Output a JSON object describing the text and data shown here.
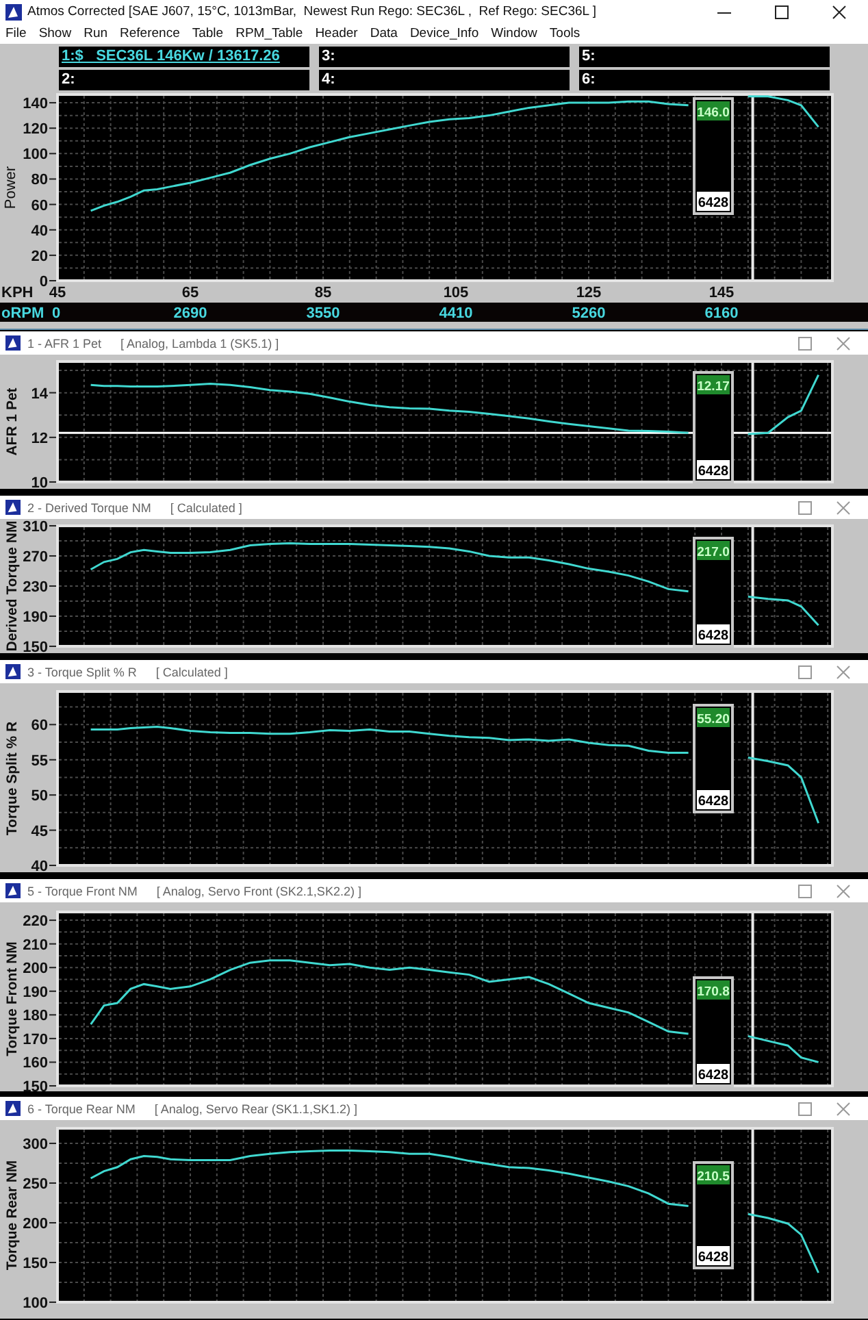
{
  "window": {
    "title": "Atmos Corrected [SAE J607, 15°C, 1013mBar,  Newest Run Rego: SEC36L ,  Ref Rego: SEC36L ]"
  },
  "menu": [
    "File",
    "Show",
    "Run",
    "Reference",
    "Table",
    "RPM_Table",
    "Header",
    "Data",
    "Device_Info",
    "Window",
    "Tools"
  ],
  "run_slots": [
    {
      "label": "1:$   SEC36L 146Kw / 13617.26",
      "selected": true
    },
    {
      "label": "3:",
      "selected": false
    },
    {
      "label": "5:",
      "selected": false
    },
    {
      "label": "2:",
      "selected": false
    },
    {
      "label": "4:",
      "selected": false
    },
    {
      "label": "6:",
      "selected": false
    }
  ],
  "main_chart": {
    "chart_data": {
      "type": "line",
      "xlabel": "KPH",
      "ylabel": "Power",
      "grid": true,
      "x": [
        50,
        52,
        54,
        56,
        58,
        60,
        62,
        65,
        68,
        71,
        74,
        77,
        80,
        83,
        86,
        89,
        92,
        95,
        98,
        101,
        104,
        107,
        110,
        113,
        116,
        119,
        122,
        125,
        128,
        131,
        134,
        137,
        140,
        143,
        146,
        149,
        152,
        155,
        157,
        159.6
      ],
      "series": [
        {
          "color": "#40d8d0",
          "values": [
            55,
            59,
            62,
            66,
            71,
            72,
            74,
            77,
            81,
            85,
            91,
            96,
            100,
            105,
            109,
            113,
            116,
            119,
            122,
            125,
            127,
            128,
            130,
            133,
            136,
            138,
            140,
            140,
            140,
            141,
            141,
            139,
            138,
            null,
            null,
            145,
            145,
            142,
            138,
            121
          ]
        }
      ],
      "xlim": [
        45,
        161.7
      ],
      "ylim": [
        0,
        146.5
      ],
      "xticks": [
        45,
        65,
        85,
        105,
        125,
        145
      ],
      "yticks": [
        0,
        20,
        40,
        60,
        80,
        100,
        120,
        140
      ],
      "ref_lines": [
        {
          "axis": "x",
          "value": 149.7
        }
      ]
    },
    "cursor": {
      "value": "146.0",
      "rpm": "6428"
    },
    "rpm_axis": {
      "label": "oRPM",
      "ticks": [
        "0",
        "2690",
        "3550",
        "4410",
        "5260",
        "6160"
      ]
    }
  },
  "panels": [
    {
      "title": "1 - AFR 1 Pet",
      "source": "[ Analog, Lambda 1 (SK5.1) ]",
      "chart_data": {
        "type": "line",
        "ylabel": "AFR 1 Pet",
        "grid": true,
        "x": [
          50,
          52,
          54,
          56,
          58,
          60,
          62,
          65,
          68,
          71,
          74,
          77,
          80,
          83,
          86,
          89,
          92,
          95,
          98,
          101,
          104,
          107,
          110,
          113,
          116,
          119,
          122,
          125,
          128,
          131,
          134,
          137,
          140,
          143,
          146,
          149,
          152,
          155,
          157,
          159.6
        ],
        "series": [
          {
            "color": "#40d8d0",
            "values": [
              14.35,
              14.3,
              14.3,
              14.28,
              14.28,
              14.28,
              14.3,
              14.35,
              14.4,
              14.35,
              14.25,
              14.12,
              14.05,
              13.95,
              13.78,
              13.6,
              13.45,
              13.35,
              13.3,
              13.28,
              13.2,
              13.15,
              13.05,
              12.95,
              12.85,
              12.72,
              12.6,
              12.5,
              12.4,
              12.3,
              12.28,
              12.25,
              12.2,
              null,
              null,
              12.15,
              12.2,
              12.9,
              13.2,
              14.8
            ]
          }
        ],
        "xlim": [
          45,
          161.7
        ],
        "ylim": [
          10,
          15.4
        ],
        "yticks": [
          10,
          12,
          14
        ],
        "ref_lines": [
          {
            "axis": "y",
            "value": 12.2
          },
          {
            "axis": "x",
            "value": 149.7
          }
        ]
      },
      "cursor": {
        "value": "12.17",
        "rpm": "6428"
      }
    },
    {
      "title": "2 - Derived Torque NM",
      "source": "[ Calculated ]",
      "chart_data": {
        "type": "line",
        "ylabel": "Derived Torque NM",
        "grid": true,
        "x": [
          50,
          52,
          54,
          56,
          58,
          60,
          62,
          65,
          68,
          71,
          74,
          77,
          80,
          83,
          86,
          89,
          92,
          95,
          98,
          101,
          104,
          107,
          110,
          113,
          116,
          119,
          122,
          125,
          128,
          131,
          134,
          137,
          140,
          143,
          146,
          149,
          152,
          155,
          157,
          159.6
        ],
        "series": [
          {
            "color": "#40d8d0",
            "values": [
              252,
              262,
              266,
              275,
              278,
              276,
              274,
              274,
              275,
              278,
              284,
              286,
              287,
              286,
              286,
              286,
              285,
              284,
              283,
              282,
              280,
              276,
              270,
              268,
              268,
              264,
              259,
              253,
              249,
              244,
              236,
              226,
              223,
              null,
              null,
              216,
              213,
              211,
              203,
              178
            ]
          }
        ],
        "xlim": [
          45,
          161.7
        ],
        "ylim": [
          150,
          310
        ],
        "yticks": [
          150,
          190,
          230,
          270,
          310
        ],
        "ref_lines": [
          {
            "axis": "x",
            "value": 149.7
          }
        ]
      },
      "cursor": {
        "value": "217.0",
        "rpm": "6428"
      }
    },
    {
      "title": "3 - Torque Split % R",
      "source": "[ Calculated ]",
      "chart_data": {
        "type": "line",
        "ylabel": "Torque Split % R",
        "grid": true,
        "x": [
          50,
          52,
          54,
          56,
          58,
          60,
          62,
          65,
          68,
          71,
          74,
          77,
          80,
          83,
          86,
          89,
          92,
          95,
          98,
          101,
          104,
          107,
          110,
          113,
          116,
          119,
          122,
          125,
          128,
          131,
          134,
          137,
          140,
          143,
          146,
          149,
          152,
          155,
          157,
          159.6
        ],
        "series": [
          {
            "color": "#40d8d0",
            "values": [
              59.3,
              59.3,
              59.3,
              59.5,
              59.6,
              59.7,
              59.5,
              59.1,
              58.9,
              58.8,
              58.8,
              58.7,
              58.7,
              58.9,
              59.2,
              59.1,
              59.3,
              59.0,
              59.0,
              58.7,
              58.4,
              58.2,
              58.1,
              57.8,
              57.9,
              57.7,
              57.9,
              57.4,
              57.1,
              57.0,
              56.3,
              56.0,
              56.0,
              null,
              null,
              55.3,
              54.8,
              54.2,
              52.5,
              46
            ]
          }
        ],
        "xlim": [
          45,
          161.7
        ],
        "ylim": [
          40,
          64.7
        ],
        "yticks": [
          40,
          45,
          50,
          55,
          60
        ],
        "ref_lines": [
          {
            "axis": "x",
            "value": 149.7
          }
        ]
      },
      "cursor": {
        "value": "55.20",
        "rpm": "6428"
      }
    },
    {
      "title": "5 - Torque Front NM",
      "source": "[ Analog, Servo Front (SK2.1,SK2.2) ]",
      "chart_data": {
        "type": "line",
        "ylabel": "Torque Front NM",
        "grid": true,
        "x": [
          50,
          52,
          54,
          56,
          58,
          60,
          62,
          65,
          68,
          71,
          74,
          77,
          80,
          83,
          86,
          89,
          92,
          95,
          98,
          101,
          104,
          107,
          110,
          113,
          116,
          119,
          122,
          125,
          128,
          131,
          134,
          137,
          140,
          143,
          146,
          149,
          152,
          155,
          157,
          159.6
        ],
        "series": [
          {
            "color": "#40d8d0",
            "values": [
              176,
              184,
              185,
              191,
              193,
              192,
              191,
              192,
              195,
              199,
              202,
              203,
              203,
              202,
              201,
              201.5,
              200,
              199,
              200,
              199,
              198,
              197,
              194,
              195,
              196,
              193,
              189,
              185,
              183,
              181,
              177,
              173,
              172,
              null,
              null,
              171,
              169,
              167,
              162,
              160
            ]
          }
        ],
        "xlim": [
          45,
          161.7
        ],
        "ylim": [
          150,
          223.5
        ],
        "yticks": [
          150,
          160,
          170,
          180,
          190,
          200,
          210,
          220
        ],
        "ref_lines": [
          {
            "axis": "x",
            "value": 149.7
          }
        ]
      },
      "cursor": {
        "value": "170.8",
        "rpm": "6428"
      }
    },
    {
      "title": "6 - Torque Rear NM",
      "source": "[ Analog, Servo Rear (SK1.1,SK1.2) ]",
      "chart_data": {
        "type": "line",
        "ylabel": "Torque Rear NM",
        "grid": true,
        "x": [
          50,
          52,
          54,
          56,
          58,
          60,
          62,
          65,
          68,
          71,
          74,
          77,
          80,
          83,
          86,
          89,
          92,
          95,
          98,
          101,
          104,
          107,
          110,
          113,
          116,
          119,
          122,
          125,
          128,
          131,
          134,
          137,
          140,
          143,
          146,
          149,
          152,
          155,
          157,
          159.6
        ],
        "series": [
          {
            "color": "#40d8d0",
            "values": [
              256,
              265,
              270,
              280,
              284,
              283,
              280,
              279,
              279,
              279,
              284,
              287,
              289,
              290,
              291,
              291,
              290,
              289,
              287,
              287,
              283,
              278,
              274,
              270,
              269,
              266,
              262,
              257,
              252,
              246,
              237,
              224,
              221,
              null,
              null,
              211,
              206,
              199,
              185,
              137
            ]
          }
        ],
        "xlim": [
          45,
          161.7
        ],
        "ylim": [
          100,
          319
        ],
        "yticks": [
          100,
          150,
          200,
          250,
          300
        ],
        "ref_lines": [
          {
            "axis": "x",
            "value": 149.7
          }
        ]
      },
      "cursor": {
        "value": "210.5",
        "rpm": "6428"
      }
    }
  ]
}
